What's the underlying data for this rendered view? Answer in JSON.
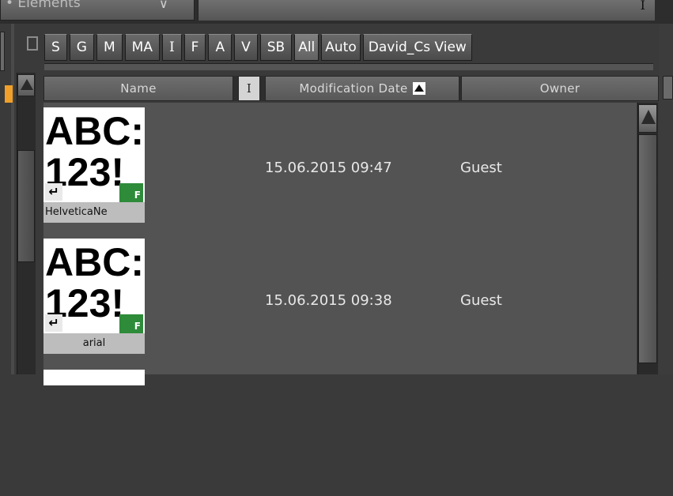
{
  "toolbar": {
    "elements_dropdown_label": "• Elements",
    "field_glyph": "I"
  },
  "tabs": [
    {
      "label": "S"
    },
    {
      "label": "G"
    },
    {
      "label": "M"
    },
    {
      "label": "MA"
    },
    {
      "label": "I"
    },
    {
      "label": "F"
    },
    {
      "label": "A"
    },
    {
      "label": "V"
    },
    {
      "label": "SB"
    },
    {
      "label": "All",
      "active": true
    },
    {
      "label": "Auto"
    },
    {
      "label": "David_Cs View"
    }
  ],
  "columns": {
    "name": "Name",
    "separator": "I",
    "modification_date": "Modification Date",
    "owner": "Owner",
    "sort": "ascending"
  },
  "rows": [
    {
      "preview": "ABC:\n123!",
      "name": "HelveticaNe",
      "badge": "F",
      "modification_date": "15.06.2015 09:47",
      "owner": "Guest"
    },
    {
      "preview": "ABC:\n123!",
      "name": "arial",
      "badge": "F",
      "modification_date": "15.06.2015 09:38",
      "owner": "Guest"
    }
  ],
  "colors": {
    "background": "#3a3a3a",
    "list_background": "#535353",
    "font_badge": "#2e8b3a",
    "marker": "#f0a02a"
  }
}
